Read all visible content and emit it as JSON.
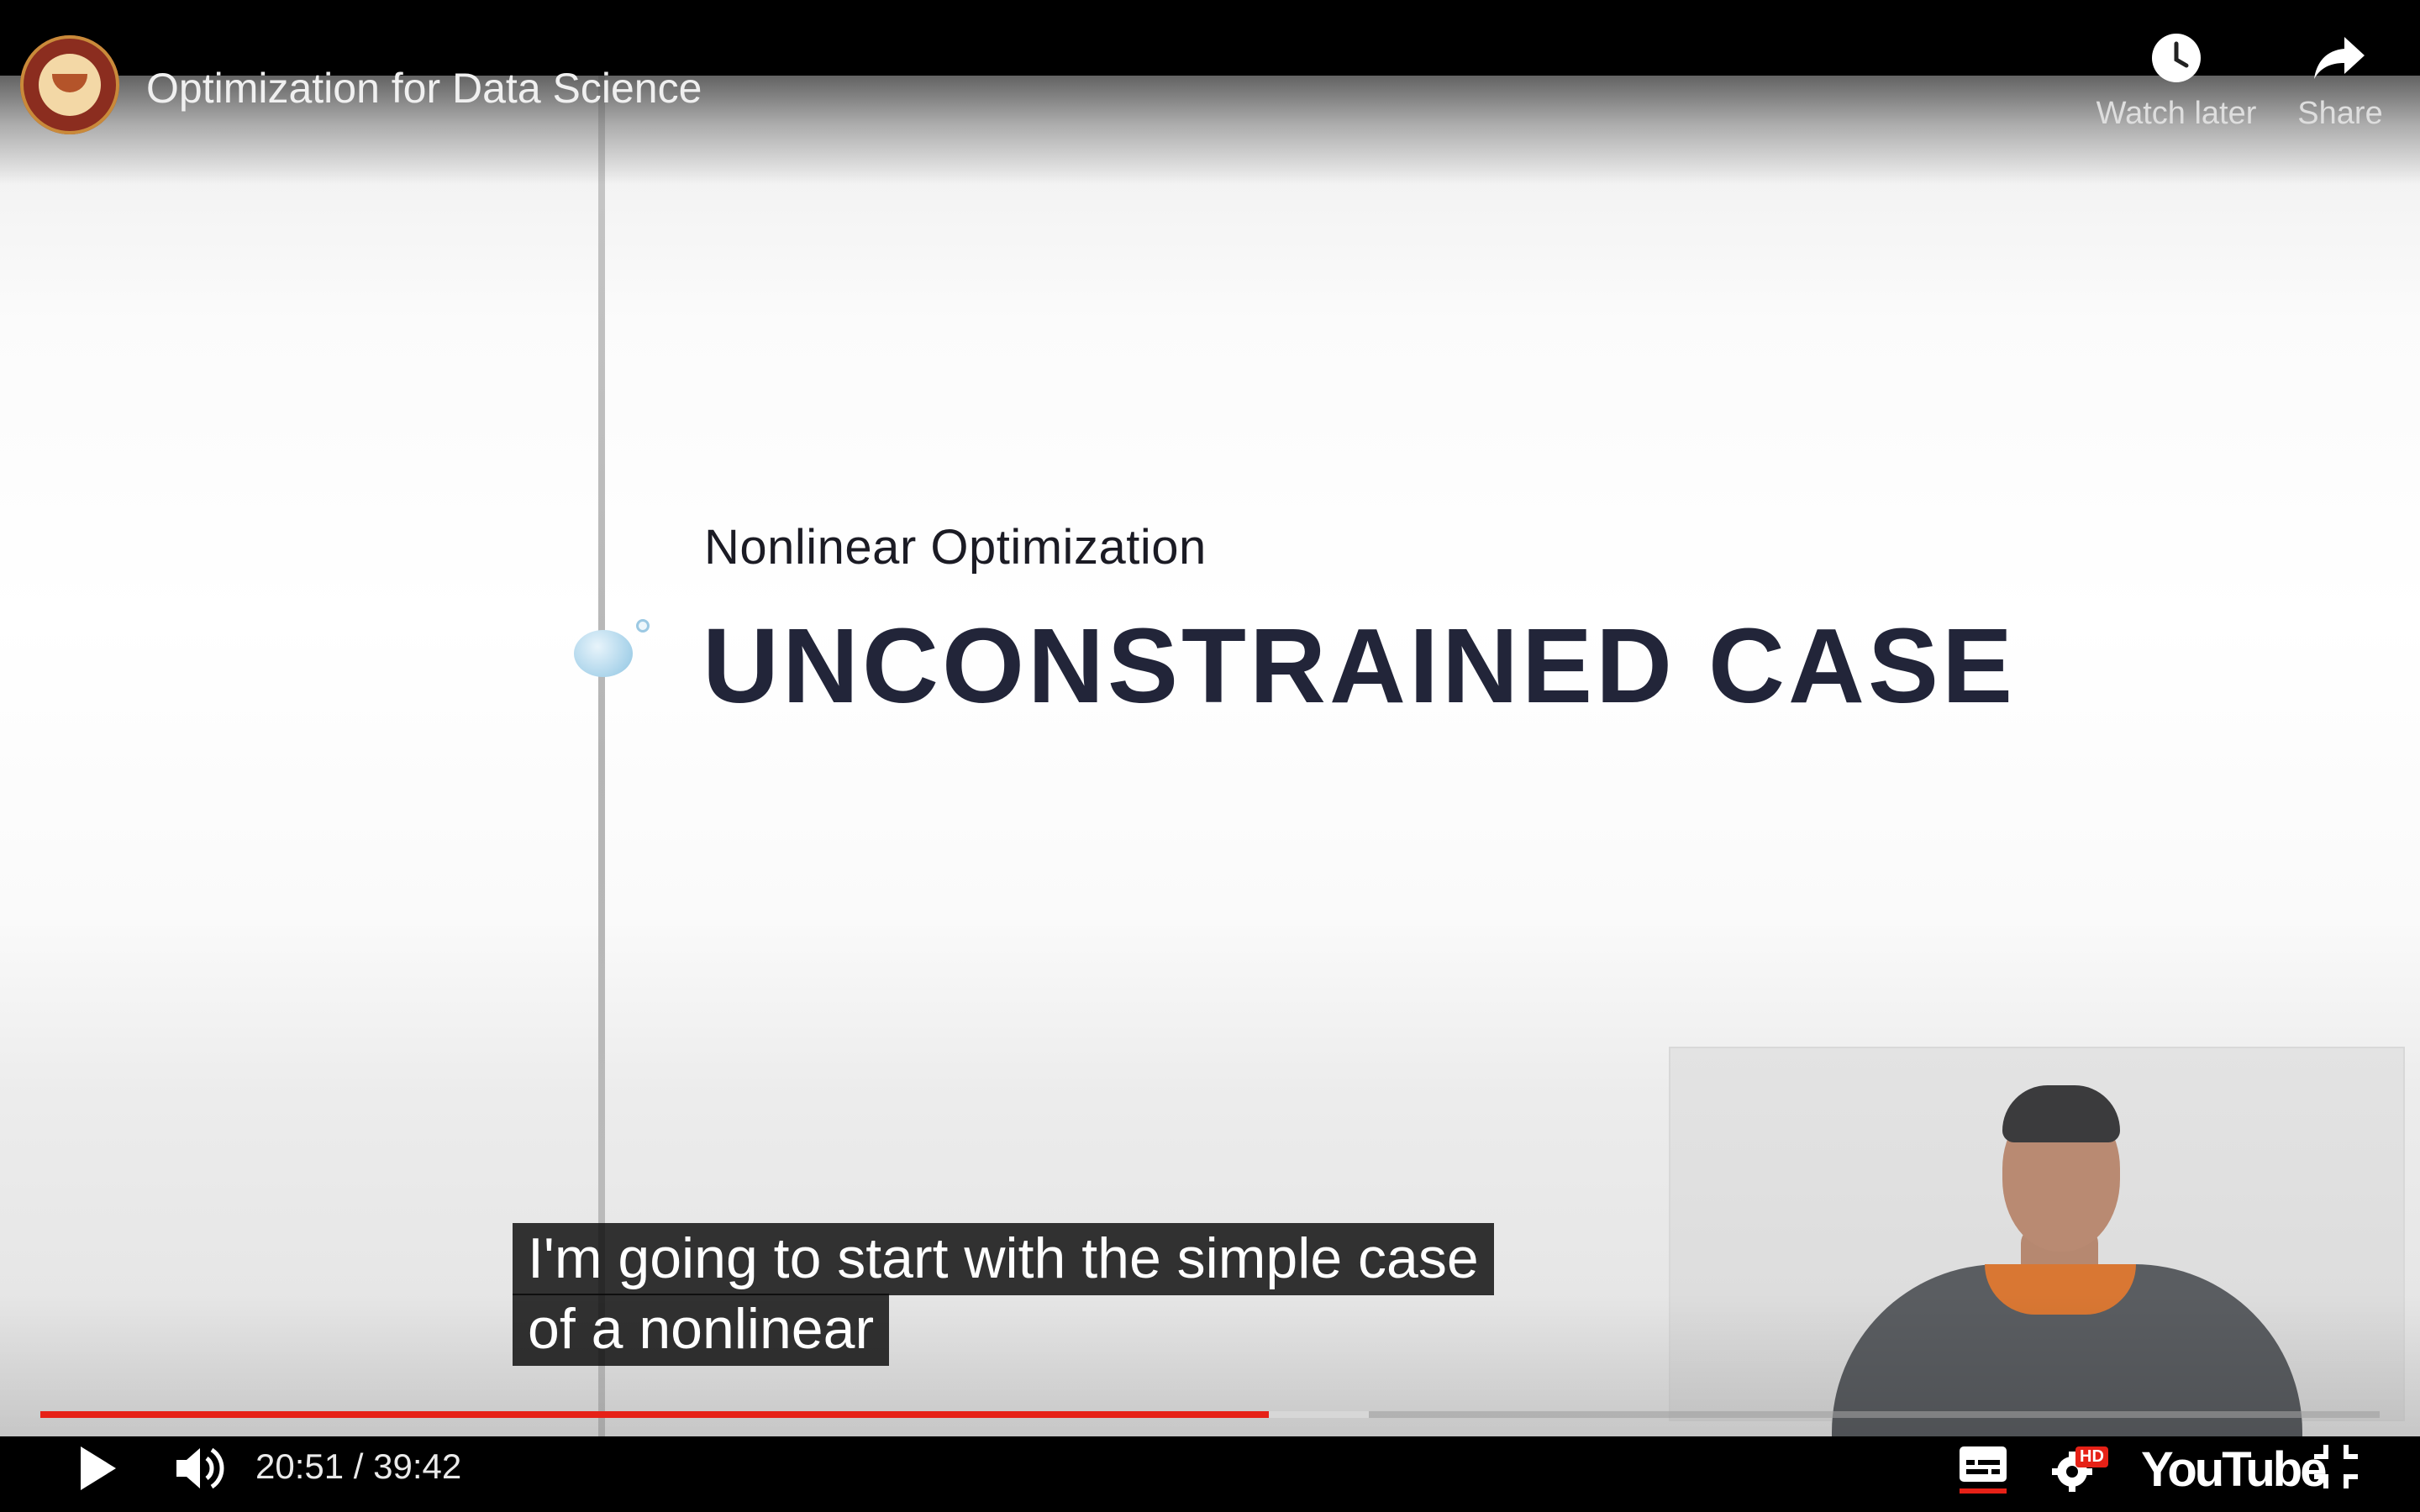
{
  "header": {
    "video_title": "Optimization for Data Science",
    "channel_logo": "channel-logo-icon",
    "watch_later_label": "Watch later",
    "share_label": "Share"
  },
  "slide": {
    "subtitle": "Nonlinear Optimization",
    "title": "UNCONSTRAINED CASE"
  },
  "captions": {
    "line1": "I'm going to start with the simple case",
    "line2": "of a nonlinear"
  },
  "player": {
    "current_time": "20:51",
    "separator": " / ",
    "duration": "39:42",
    "time_display": "20:51 / 39:42",
    "progress_played_fraction": 0.525,
    "progress_buffered_fraction": 0.568,
    "hd_badge": "HD",
    "brand_logo": "YouTube",
    "colors": {
      "progress": "#e62117",
      "controls_bg": "#000000"
    }
  },
  "icons": {
    "play": "play-icon",
    "volume": "volume-icon",
    "subtitles": "subtitles-icon",
    "settings": "settings-gear-icon",
    "exit_fullscreen": "exit-fullscreen-icon",
    "clock": "clock-icon",
    "share_arrow": "share-arrow-icon"
  }
}
